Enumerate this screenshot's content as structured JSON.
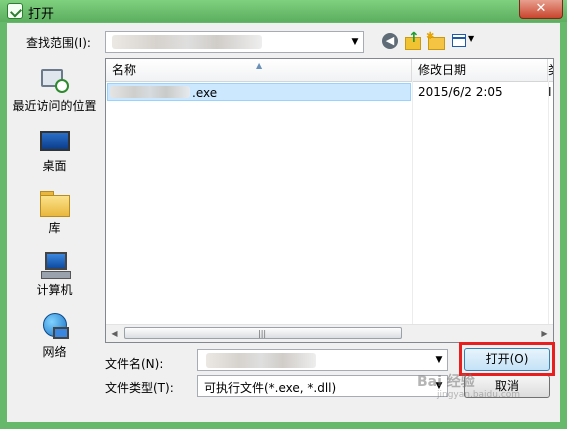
{
  "window": {
    "title": "打开",
    "close_glyph": "✕"
  },
  "toolbar": {
    "look_in_label": "查找范围(I):",
    "back_glyph": "◀",
    "up_glyph": "↑",
    "new_folder_glyph": "✱",
    "view_dropdown_glyph": "▼"
  },
  "places": {
    "recent": "最近访问的位置",
    "desktop": "桌面",
    "library": "库",
    "computer": "计算机",
    "network": "网络"
  },
  "list": {
    "columns": {
      "name": "名称",
      "date": "修改日期",
      "more": "类"
    },
    "sort_glyph": "▲",
    "rows": [
      {
        "name_suffix": ".exe",
        "date": "2015/6/2 2:05",
        "more": "I"
      }
    ],
    "scroll_left": "◀",
    "scroll_right": "▶",
    "scroll_grip": "|||"
  },
  "form": {
    "filename_label": "文件名(N):",
    "filetype_label": "文件类型(T):",
    "filetype_value": "可执行文件(*.exe, *.dll)",
    "dropdown_glyph": "▼"
  },
  "buttons": {
    "open": "打开(O)",
    "cancel": "取消"
  },
  "watermark": {
    "text": "Bai 经验",
    "sub": "jingyan.baidu.com"
  }
}
